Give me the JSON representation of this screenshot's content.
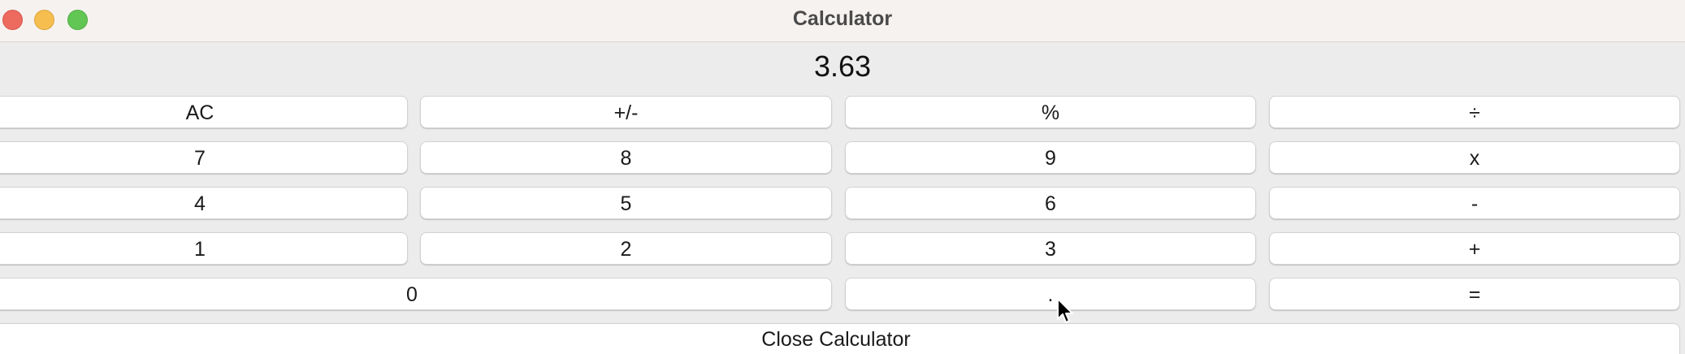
{
  "window": {
    "title": "Calculator"
  },
  "display": {
    "value": "3.63"
  },
  "keys": {
    "ac": "AC",
    "sign": "+/-",
    "percent": "%",
    "divide": "÷",
    "seven": "7",
    "eight": "8",
    "nine": "9",
    "multiply": "x",
    "four": "4",
    "five": "5",
    "six": "6",
    "subtract": "-",
    "one": "1",
    "two": "2",
    "three": "3",
    "add": "+",
    "zero": "0",
    "decimal": ".",
    "equals": "="
  },
  "footer": {
    "close_label": "Close Calculator"
  },
  "colors": {
    "close": "#ed6a5e",
    "minimize": "#f5be4f",
    "maximize": "#62c655"
  },
  "icons": {
    "close": "close-icon",
    "minimize": "minimize-icon",
    "maximize": "maximize-icon",
    "cursor": "mouse-pointer-icon"
  }
}
